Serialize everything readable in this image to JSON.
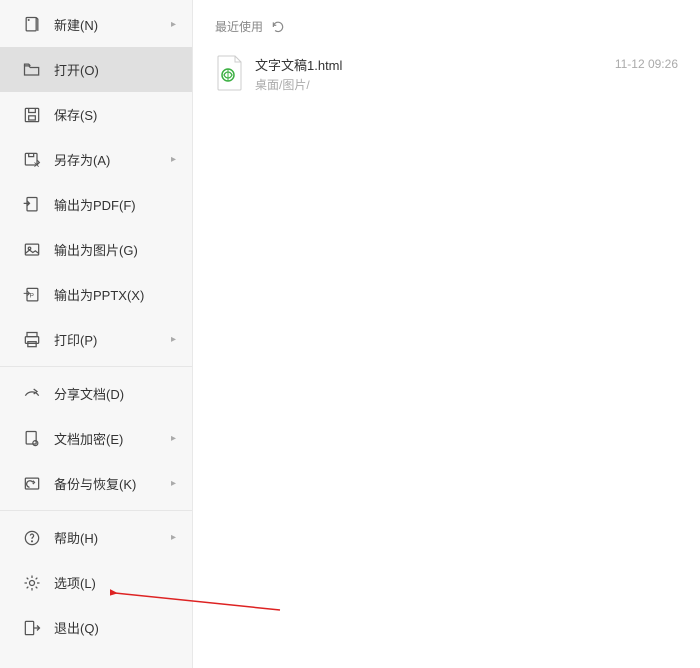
{
  "sidebar": {
    "items": [
      {
        "label": "新建(N)",
        "icon": "new-file",
        "submenu": true
      },
      {
        "label": "打开(O)",
        "icon": "open-folder",
        "submenu": false,
        "active": true
      },
      {
        "label": "保存(S)",
        "icon": "save",
        "submenu": false
      },
      {
        "label": "另存为(A)",
        "icon": "save-as",
        "submenu": true
      },
      {
        "label": "输出为PDF(F)",
        "icon": "export-pdf",
        "submenu": false
      },
      {
        "label": "输出为图片(G)",
        "icon": "export-image",
        "submenu": false
      },
      {
        "label": "输出为PPTX(X)",
        "icon": "export-pptx",
        "submenu": false
      },
      {
        "label": "打印(P)",
        "icon": "print",
        "submenu": true
      },
      {
        "label": "分享文档(D)",
        "icon": "share",
        "submenu": false
      },
      {
        "label": "文档加密(E)",
        "icon": "encrypt",
        "submenu": true
      },
      {
        "label": "备份与恢复(K)",
        "icon": "backup",
        "submenu": true
      },
      {
        "label": "帮助(H)",
        "icon": "help",
        "submenu": true
      },
      {
        "label": "选项(L)",
        "icon": "options",
        "submenu": false
      },
      {
        "label": "退出(Q)",
        "icon": "exit",
        "submenu": false
      }
    ]
  },
  "main": {
    "recent_label": "最近使用",
    "files": [
      {
        "name": "文字文稿1.html",
        "path": "桌面/图片/",
        "time": "11-12 09:26"
      }
    ]
  }
}
